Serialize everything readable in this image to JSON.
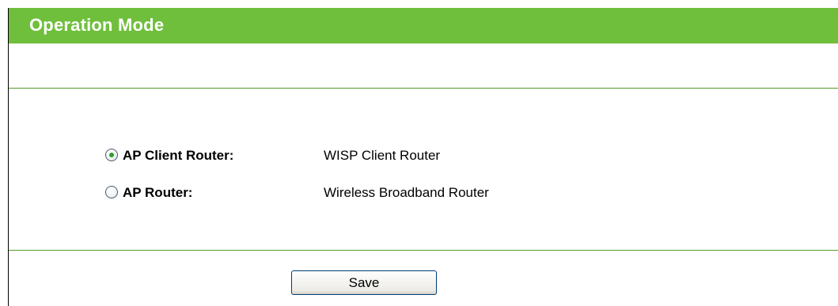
{
  "header": {
    "title": "Operation Mode"
  },
  "modes": [
    {
      "label": "AP Client Router:",
      "description": "WISP Client Router",
      "selected": true
    },
    {
      "label": "AP Router:",
      "description": "Wireless Broadband Router",
      "selected": false
    }
  ],
  "actions": {
    "save_label": "Save"
  },
  "colors": {
    "header_bg": "#6fbf3d",
    "divider": "#4e9f2a",
    "radio_dot": "#2f9e2f"
  }
}
